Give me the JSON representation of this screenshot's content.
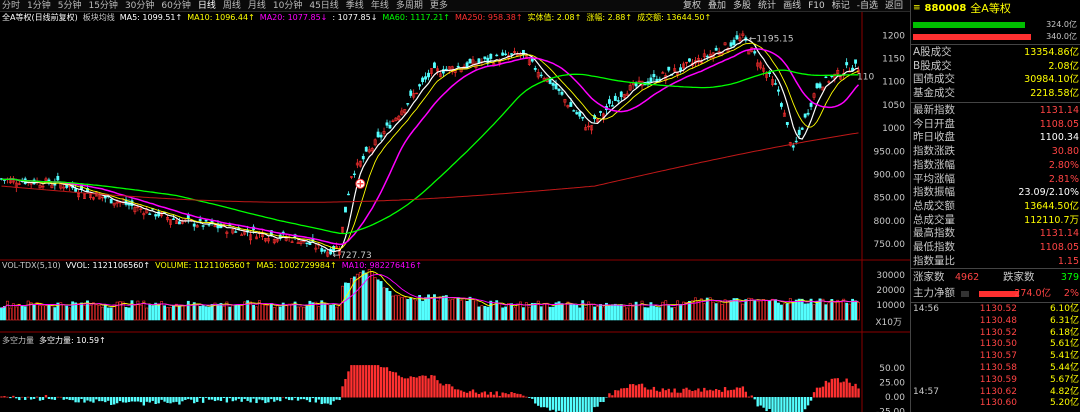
{
  "toolbar": {
    "timeframes": [
      "分时",
      "1分钟",
      "5分钟",
      "15分钟",
      "30分钟",
      "60分钟",
      "日线",
      "周线",
      "月线",
      "10分钟",
      "45日线",
      "季线",
      "年线",
      "多周期",
      "更多"
    ],
    "active_timeframe": "日线",
    "tools": [
      "复权",
      "叠加",
      "多股",
      "统计",
      "画线",
      "F10",
      "标记",
      "-自选",
      "返回"
    ]
  },
  "main_legend": [
    {
      "text": "全A等权(日线前复权)",
      "color": "#ffffff"
    },
    {
      "text": "板块均线",
      "color": "#c8c8c8"
    },
    {
      "text": "MA5: 1099.51↑",
      "color": "#ffffff"
    },
    {
      "text": "MA10: 1096.44↑",
      "color": "#ffff00"
    },
    {
      "text": "MA20: 1077.85↓",
      "color": "#ff00ff"
    },
    {
      "text": ": 1077.85↓",
      "color": "#ffffff"
    },
    {
      "text": "MA60: 1117.21↑",
      "color": "#00ff00"
    },
    {
      "text": "MA250: 958.38↑",
      "color": "#ff3030"
    },
    {
      "text": "实体值: 2.08↑",
      "color": "#ffff00"
    },
    {
      "text": "涨幅: 2.88↑",
      "color": "#ffff00"
    },
    {
      "text": "成交额: 13644.50↑",
      "color": "#ffff00"
    }
  ],
  "vol_legend": [
    {
      "text": "VOL-TDX(5,10)",
      "color": "#c8c8c8"
    },
    {
      "text": "VVOL: 1121106560↑",
      "color": "#ffffff"
    },
    {
      "text": "VOLUME: 1121106560↑",
      "color": "#ffff00"
    },
    {
      "text": "MA5: 1002729984↑",
      "color": "#ffff00"
    },
    {
      "text": "MA10: 982276416↑",
      "color": "#ff00ff"
    }
  ],
  "dk_legend": [
    {
      "text": "多空力量",
      "color": "#c8c8c8"
    },
    {
      "text": "多空力量: 10.59↑",
      "color": "#ffffff"
    }
  ],
  "chart_data": {
    "type": "candlestick",
    "price_axis": {
      "labels": [
        "1200",
        "1150",
        "1100",
        "1050",
        "1000",
        "950.00",
        "900.00",
        "850.00",
        "800.00",
        "750.00"
      ],
      "ylim": [
        720,
        1220
      ]
    },
    "volume_axis": {
      "labels": [
        "30000",
        "20000",
        "10000"
      ],
      "unit": "X10万"
    },
    "dk_axis": {
      "labels": [
        "50.00",
        "25.00",
        "0.00",
        "-25.00"
      ]
    },
    "annotations": {
      "high_label": "1195.15",
      "low_label": "727.73",
      "right_label": "110"
    },
    "ohlc_key_points": [
      {
        "i": 0,
        "c": 890
      },
      {
        "i": 20,
        "c": 880
      },
      {
        "i": 40,
        "c": 840
      },
      {
        "i": 60,
        "c": 800
      },
      {
        "i": 80,
        "c": 780
      },
      {
        "i": 100,
        "c": 760
      },
      {
        "i": 110,
        "c": 735
      },
      {
        "i": 114,
        "c": 745
      },
      {
        "i": 118,
        "c": 900
      },
      {
        "i": 130,
        "c": 1000
      },
      {
        "i": 145,
        "c": 1120
      },
      {
        "i": 160,
        "c": 1140
      },
      {
        "i": 175,
        "c": 1160
      },
      {
        "i": 185,
        "c": 1100
      },
      {
        "i": 198,
        "c": 1000
      },
      {
        "i": 210,
        "c": 1080
      },
      {
        "i": 230,
        "c": 1130
      },
      {
        "i": 250,
        "c": 1195
      },
      {
        "i": 262,
        "c": 1080
      },
      {
        "i": 267,
        "c": 950
      },
      {
        "i": 275,
        "c": 1090
      },
      {
        "i": 286,
        "c": 1131
      }
    ]
  },
  "panel": {
    "code": "880008",
    "name": "全A等权",
    "bars": [
      {
        "value": "324.0亿",
        "color": "#00c000",
        "fraction": 0.95
      },
      {
        "value": "340.0亿",
        "color": "#ff3030",
        "fraction": 1.0
      }
    ],
    "stats_a": [
      {
        "label": "A股成交",
        "value": "13354.86亿",
        "color": "#ffff00"
      },
      {
        "label": "B股成交",
        "value": "2.08亿",
        "color": "#ffff00"
      },
      {
        "label": "国债成交",
        "value": "30984.10亿",
        "color": "#ffff00"
      },
      {
        "label": "基金成交",
        "value": "2218.58亿",
        "color": "#ffff00"
      }
    ],
    "stats_b": [
      {
        "label": "最新指数",
        "value": "1131.14",
        "color": "#ff4444"
      },
      {
        "label": "今日开盘",
        "value": "1108.05",
        "color": "#ff4444"
      },
      {
        "label": "昨日收盘",
        "value": "1100.34",
        "color": "#ffffff"
      },
      {
        "label": "指数涨跌",
        "value": "30.80",
        "color": "#ff4444"
      },
      {
        "label": "指数涨幅",
        "value": "2.80%",
        "color": "#ff4444"
      },
      {
        "label": "平均涨幅",
        "value": "2.81%",
        "color": "#ff4444"
      },
      {
        "label": "指数振幅",
        "value": "23.09/2.10%",
        "color": "#ffffff"
      },
      {
        "label": "总成交额",
        "value": "13644.50亿",
        "color": "#ffff00"
      },
      {
        "label": "总成交量",
        "value": "112110.7万",
        "color": "#ffff00"
      },
      {
        "label": "最高指数",
        "value": "1131.14",
        "color": "#ff4444"
      },
      {
        "label": "最低指数",
        "value": "1108.05",
        "color": "#ff4444"
      },
      {
        "label": "指数量比",
        "value": "1.15",
        "color": "#ff4444"
      }
    ],
    "breadth": {
      "up_label": "涨家数",
      "up": "4962",
      "down_label": "跌家数",
      "down": "379"
    },
    "net_flow": {
      "label": "主力净额",
      "value": "274.0亿",
      "pct": "2%"
    },
    "trades": [
      {
        "time": "14:56",
        "price": "1130.52",
        "vol": "6.10亿"
      },
      {
        "time": "",
        "price": "1130.48",
        "vol": "6.31亿"
      },
      {
        "time": "",
        "price": "1130.52",
        "vol": "6.18亿"
      },
      {
        "time": "",
        "price": "1130.50",
        "vol": "5.61亿"
      },
      {
        "time": "",
        "price": "1130.57",
        "vol": "5.41亿"
      },
      {
        "time": "",
        "price": "1130.58",
        "vol": "5.44亿"
      },
      {
        "time": "",
        "price": "1130.59",
        "vol": "5.67亿"
      },
      {
        "time": "14:57",
        "price": "1130.62",
        "vol": "4.82亿"
      },
      {
        "time": "",
        "price": "1130.60",
        "vol": "5.20亿"
      }
    ]
  }
}
